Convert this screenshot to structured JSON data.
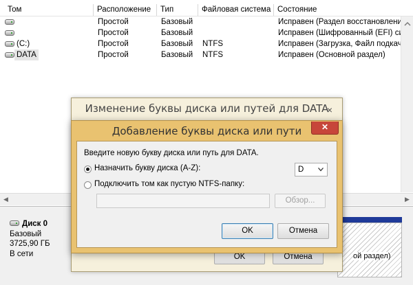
{
  "columns": [
    "Том",
    "Расположение",
    "Тип",
    "Файловая система",
    "Состояние"
  ],
  "volumes": [
    {
      "name": "",
      "location": "Простой",
      "type": "Базовый",
      "fs": "",
      "status": "Исправен (Раздел восстановления"
    },
    {
      "name": "",
      "location": "Простой",
      "type": "Базовый",
      "fs": "",
      "status": "Исправен (Шифрованный (EFI) сис"
    },
    {
      "name": "(C:)",
      "location": "Простой",
      "type": "Базовый",
      "fs": "NTFS",
      "status": "Исправен (Загрузка, Файл подкач"
    },
    {
      "name": "DATA",
      "location": "Простой",
      "type": "Базовый",
      "fs": "NTFS",
      "status": "Исправен (Основной раздел)"
    }
  ],
  "disk": {
    "name": "Диск 0",
    "type": "Базовый",
    "size": "3725,90 ГБ",
    "state": "В сети",
    "partition_text": "ой раздел)"
  },
  "back_dialog": {
    "title": "Изменение буквы диска или путей для DATA",
    "close": "×",
    "ok": "OK",
    "cancel": "Отмена"
  },
  "dialog": {
    "title": "Добавление буквы диска или пути",
    "close": "✕",
    "prompt": "Введите новую букву диска или путь для DATA.",
    "option_letter": "Назначить букву диска (A-Z):",
    "letter_value": "D",
    "option_folder": "Подключить том как пустую NTFS-папку:",
    "folder_path": "",
    "browse": "Обзор...",
    "ok": "OK",
    "cancel": "Отмена"
  },
  "icons": {
    "disk": "drive-icon",
    "dropdown": "chevron-down-icon"
  }
}
